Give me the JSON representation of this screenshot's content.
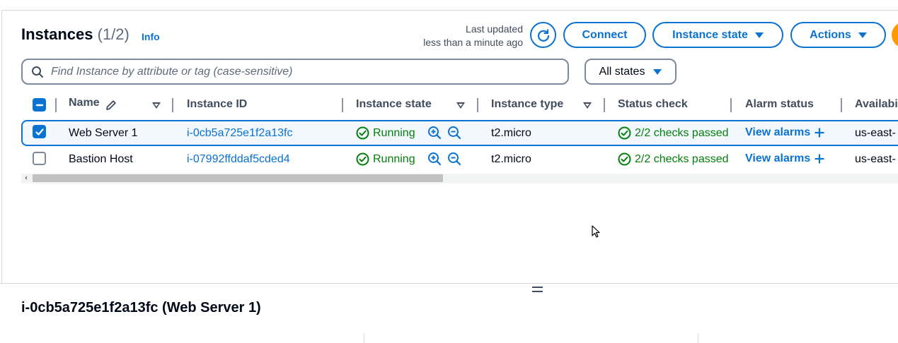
{
  "header": {
    "title": "Instances",
    "count": "(1/2)",
    "info": "Info",
    "last_updated_line1": "Last updated",
    "last_updated_line2": "less than a minute ago",
    "connect_label": "Connect",
    "instance_state_label": "Instance state",
    "actions_label": "Actions"
  },
  "search": {
    "placeholder": "Find Instance by attribute or tag (case-sensitive)",
    "value": ""
  },
  "filter": {
    "selected": "All states"
  },
  "table": {
    "columns": [
      "Name",
      "Instance ID",
      "Instance state",
      "Instance type",
      "Status check",
      "Alarm status",
      "Availabi"
    ],
    "rows": [
      {
        "selected": true,
        "name": "Web Server 1",
        "instance_id": "i-0cb5a725e1f2a13fc",
        "state": "Running",
        "type": "t2.micro",
        "status_check": "2/2 checks passed",
        "alarm": "View alarms",
        "availability": "us-east-"
      },
      {
        "selected": false,
        "name": "Bastion Host",
        "instance_id": "i-07992ffddaf5cded4",
        "state": "Running",
        "type": "t2.micro",
        "status_check": "2/2 checks passed",
        "alarm": "View alarms",
        "availability": "us-east-"
      }
    ]
  },
  "scrollbar": {
    "position_fraction": 0.0,
    "visible_fraction": 0.46
  },
  "details": {
    "title": "i-0cb5a725e1f2a13fc (Web Server 1)"
  },
  "colors": {
    "link": "#0972d3",
    "success": "#037f0c",
    "accent_orange": "#ff9900"
  },
  "icons": [
    "refresh-icon",
    "caret-down-icon",
    "search-icon",
    "edit-pencil-icon",
    "sort-caret-icon",
    "check-circle-icon",
    "zoom-in-icon",
    "zoom-out-icon",
    "plus-icon",
    "resize-handle-icon",
    "mouse-cursor-icon"
  ]
}
